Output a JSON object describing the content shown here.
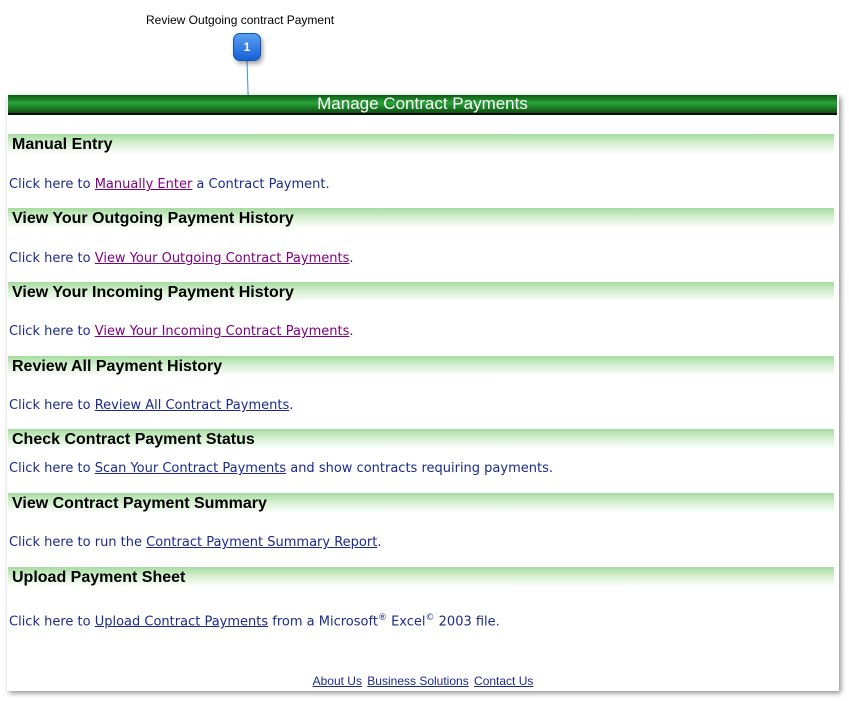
{
  "callout": {
    "title": "Review Outgoing contract Payment",
    "badge": "1"
  },
  "banner": {
    "title": "Manage Contract Payments"
  },
  "sections": [
    {
      "heading": "Manual Entry",
      "prefix": "Click here to ",
      "link": "Manually Enter",
      "suffix": " a Contract Payment."
    },
    {
      "heading": "View Your Outgoing Payment History",
      "prefix": "Click here to ",
      "link": "View Your Outgoing Contract Payments",
      "suffix": "."
    },
    {
      "heading": "View Your Incoming Payment History",
      "prefix": "Click here to ",
      "link": "View Your Incoming Contract Payments",
      "suffix": "."
    },
    {
      "heading": "Review All Payment History",
      "prefix": "Click here to ",
      "link": "Review All Contract Payments",
      "suffix": "."
    },
    {
      "heading": "Check Contract Payment Status",
      "prefix": "Click here to ",
      "link": "Scan Your Contract Payments",
      "suffix": " and show contracts requiring payments."
    },
    {
      "heading": "View Contract Payment Summary",
      "prefix": "Click here to run the ",
      "link": "Contract Payment Summary Report",
      "suffix": "."
    },
    {
      "heading": "Upload Payment Sheet",
      "prefix": "Click here to ",
      "link": "Upload Contract Payments",
      "suffix_a": " from a Microsoft",
      "reg1": "®",
      "suffix_b": " Excel",
      "reg2": "©",
      "suffix_c": " 2003 file."
    }
  ],
  "footer": {
    "about": "About Us",
    "business": "Business Solutions",
    "contact": "Contact Us"
  },
  "colors": {
    "link": "#1b2a8c",
    "visited_link": "#800080",
    "banner_green": "#1e8a2c",
    "callout_blue": "#1e6fe0"
  }
}
